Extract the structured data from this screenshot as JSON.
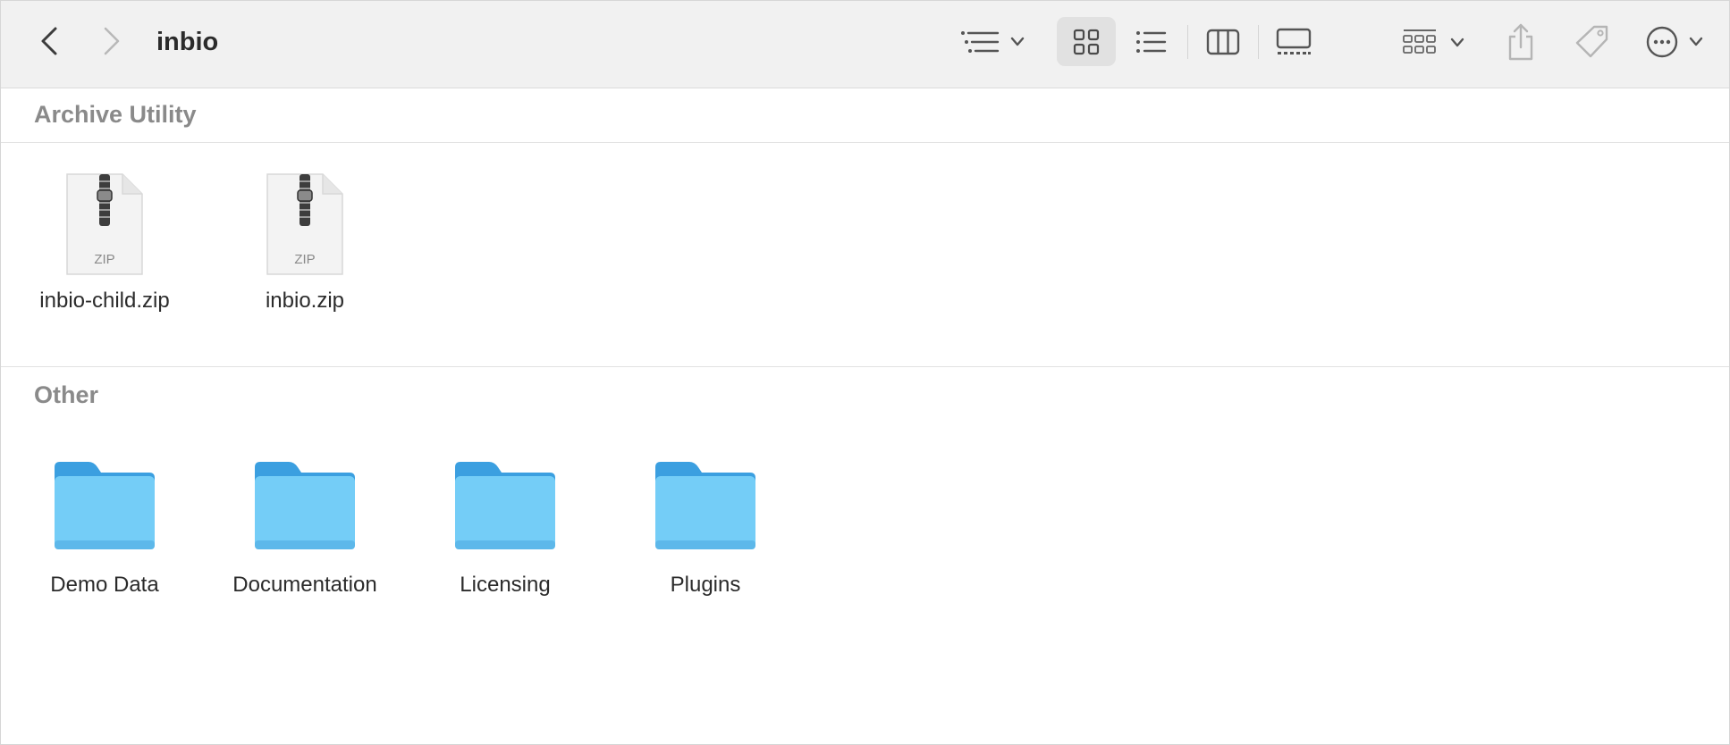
{
  "window": {
    "title": "inbio"
  },
  "toolbar": {
    "back_icon": "chevron-left-icon",
    "forward_icon": "chevron-right-icon",
    "sort_icon": "list-sort-icon",
    "view_modes": [
      "icons",
      "list",
      "columns",
      "gallery"
    ],
    "active_view": "icons",
    "group_icon": "group-grid-icon",
    "share_icon": "share-icon",
    "tag_icon": "tag-icon",
    "more_icon": "ellipsis-circle-icon"
  },
  "sections": [
    {
      "title": "Archive Utility",
      "items": [
        {
          "name": "inbio-child.zip",
          "kind": "zip",
          "badge": "ZIP"
        },
        {
          "name": "inbio.zip",
          "kind": "zip",
          "badge": "ZIP"
        }
      ]
    },
    {
      "title": "Other",
      "items": [
        {
          "name": "Demo Data",
          "kind": "folder"
        },
        {
          "name": "Documentation",
          "kind": "folder"
        },
        {
          "name": "Licensing",
          "kind": "folder"
        },
        {
          "name": "Plugins",
          "kind": "folder"
        }
      ]
    }
  ],
  "colors": {
    "folder_light": "#74cdf7",
    "folder_dark": "#3b9fe0",
    "toolbar_bg": "#f1f1f1",
    "section_header_text": "#8a8a8a"
  }
}
